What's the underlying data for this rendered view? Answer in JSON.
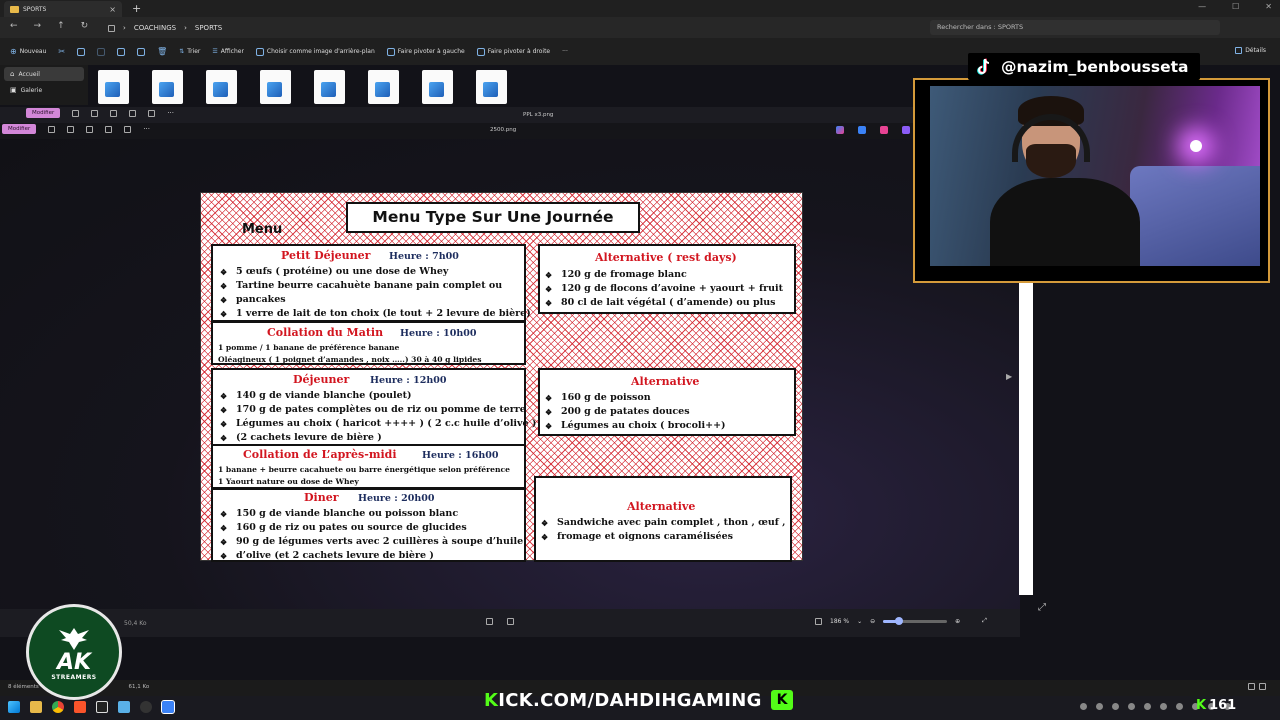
{
  "explorer": {
    "tab_title": "SPORTS",
    "breadcrumbs": [
      "COACHINGS",
      "SPORTS"
    ],
    "search_placeholder": "Rechercher dans : SPORTS",
    "ribbon": {
      "new": "Nouveau",
      "sort": "Trier",
      "view": "Afficher",
      "set_background": "Choisir comme image d'arrière-plan",
      "rotate_left": "Faire pivoter à gauche",
      "rotate_right": "Faire pivoter à droite",
      "details": "Détails"
    },
    "sidebar": [
      {
        "label": "Accueil"
      },
      {
        "label": "Galerie"
      }
    ],
    "status_left": "8 éléments",
    "status_size": "61,1 Ko"
  },
  "viewer": {
    "edit_label": "Modifier",
    "back_title": "PPL x3.png",
    "file_title": "2500.png",
    "file_size": "50,4 Ko",
    "zoom": "186 %",
    "zoom_fraction": 0.25
  },
  "menu_image": {
    "title": "Menu Type Sur Une Journée",
    "label": "Menu",
    "petit_dejeuner": {
      "heading": "Petit Déjeuner",
      "hour": "Heure : 7h00",
      "items": [
        "5 œufs ( protéine) ou une dose de Whey",
        "Tartine beurre cacahuète banane pain complet ou",
        "1 verre de lait de ton choix  (le tout + 2 levure de bière)"
      ],
      "continuation": "pancakes"
    },
    "collation_matin": {
      "heading": "Collation du Matin",
      "hour": "Heure : 10h00",
      "lines": [
        "1 pomme / 1 banane de préférence banane",
        "Oléagineux ( 1 poignet d’amandes , noix …..) 30 à 40 g    lipides"
      ]
    },
    "dejeuner": {
      "heading": "Déjeuner",
      "hour": "Heure : 12h00",
      "items": [
        "140 g de viande blanche (poulet)",
        "170 g de pates complètes ou de riz ou pomme de terre",
        "Légumes au choix ( haricot ++++ ) ( 2 c.c huile d’olive )",
        "(2 cachets levure de bière )"
      ]
    },
    "collation_apres_midi": {
      "heading": "Collation de L’après-midi",
      "hour": "Heure : 16h00",
      "lines": [
        "1 banane + beurre cacahuete ou barre énergétique selon préférence",
        "1 Yaourt nature  ou dose de Whey"
      ]
    },
    "diner": {
      "heading": "Diner",
      "hour": "Heure : 20h00",
      "items": [
        "150 g de viande blanche  ou poisson blanc",
        "160 g de riz ou pates ou source de glucides",
        "90 g de légumes verts avec 2 cuillères à soupe d’huile"
      ],
      "continuation": "d’olive  (et  2  cachets levure de bière )"
    },
    "alt_rest": {
      "heading": "Alternative  ( rest days)",
      "items": [
        "120 g de fromage blanc",
        "120 g de flocons d’avoine + yaourt + fruit",
        "80 cl de lait végétal ( d’amende)  ou plus"
      ]
    },
    "alt_lunch": {
      "heading": "Alternative",
      "items": [
        "160 g de poisson",
        "200 g de patates douces",
        "Légumes au choix ( brocoli++)"
      ]
    },
    "alt_dinner": {
      "heading": "Alternative",
      "items": [
        "Sandwiche avec pain complet , thon , œuf ,"
      ],
      "continuation": "fromage et oignons caramélisées"
    }
  },
  "overlays": {
    "tiktok_handle": "@nazim_benbousseta",
    "ak_logo": "AK",
    "ak_sub": "STREAMERS",
    "kick_prefix": "K",
    "kick_rest": "ICK.COM/DAHDIHGAMING",
    "kick_badge": "K",
    "viewer_prefix": "K",
    "viewer_count": "161"
  },
  "colors": {
    "heading_red": "#d2151f",
    "hour_navy": "#1d2d5e",
    "kick_green": "#53fc18",
    "edit_pink": "#d387d8",
    "frame_gold": "#d49a3a"
  }
}
